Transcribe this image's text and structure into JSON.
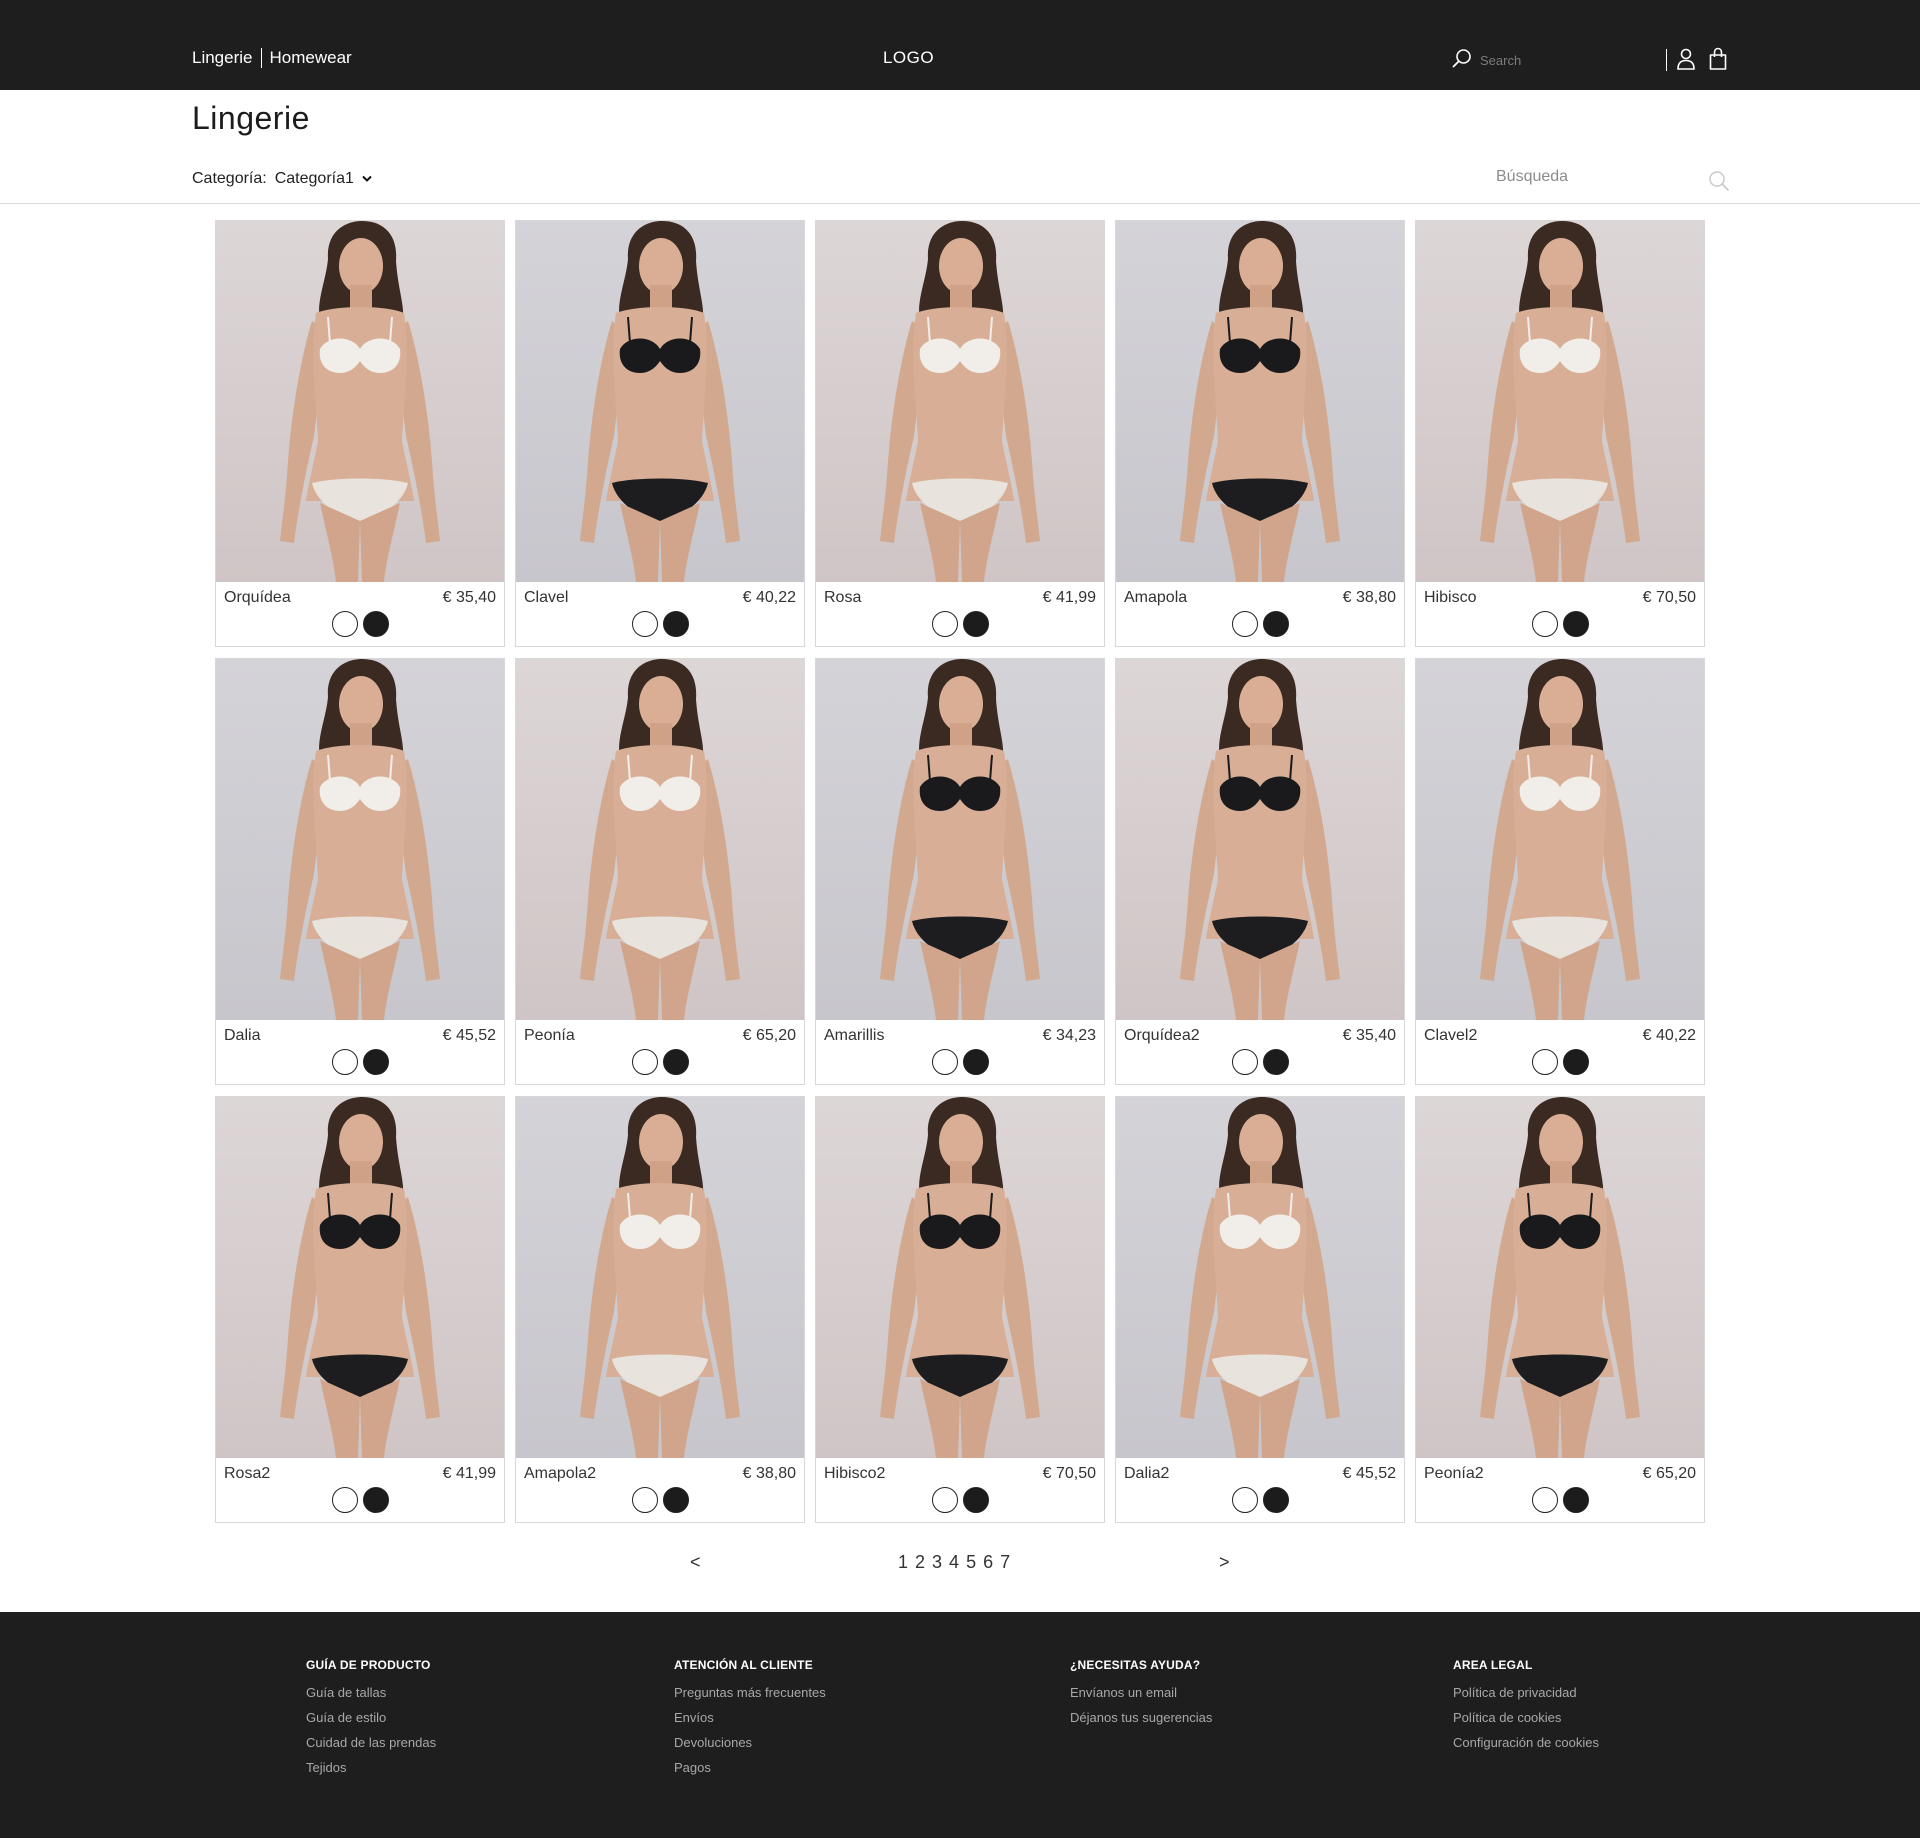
{
  "header": {
    "nav": [
      "Lingerie",
      "Homewear"
    ],
    "logo": "LOGO",
    "search_placeholder": "Search"
  },
  "page": {
    "title": "Lingerie",
    "filter_label": "Categoría:",
    "filter_value": "Categoría1",
    "search_placeholder": "Búsqueda"
  },
  "products": [
    {
      "name": "Orquídea",
      "price": "€ 35,40",
      "outfit": "white"
    },
    {
      "name": "Clavel",
      "price": "€ 40,22",
      "outfit": "black"
    },
    {
      "name": "Rosa",
      "price": "€ 41,99",
      "outfit": "white"
    },
    {
      "name": "Amapola",
      "price": "€ 38,80",
      "outfit": "black"
    },
    {
      "name": "Hibisco",
      "price": "€ 70,50",
      "outfit": "white"
    },
    {
      "name": "Dalia",
      "price": "€ 45,52",
      "outfit": "white"
    },
    {
      "name": "Peonía",
      "price": "€ 65,20",
      "outfit": "white"
    },
    {
      "name": "Amarillis",
      "price": "€ 34,23",
      "outfit": "black"
    },
    {
      "name": "Orquídea2",
      "price": "€ 35,40",
      "outfit": "black"
    },
    {
      "name": "Clavel2",
      "price": "€ 40,22",
      "outfit": "white"
    },
    {
      "name": "Rosa2",
      "price": "€ 41,99",
      "outfit": "black"
    },
    {
      "name": "Amapola2",
      "price": "€ 38,80",
      "outfit": "white"
    },
    {
      "name": "Hibisco2",
      "price": "€ 70,50",
      "outfit": "black"
    },
    {
      "name": "Dalia2",
      "price": "€ 45,52",
      "outfit": "white"
    },
    {
      "name": "Peonía2",
      "price": "€ 65,20",
      "outfit": "black"
    }
  ],
  "pagination": {
    "prev": "<",
    "next": ">",
    "pages": [
      "1",
      "2",
      "3",
      "4",
      "5",
      "6",
      "7"
    ]
  },
  "footer": {
    "columns": [
      {
        "title": "GUÍA DE PRODUCTO",
        "links": [
          "Guía de tallas",
          "Guía de estilo",
          "Cuidad de las prendas",
          "Tejidos"
        ]
      },
      {
        "title": "ATENCIÓN AL CLIENTE",
        "links": [
          "Preguntas más frecuentes",
          "Envíos",
          "Devoluciones",
          "Pagos"
        ]
      },
      {
        "title": "¿NECESITAS AYUDA?",
        "links": [
          "Envíanos un email",
          "Déjanos tus sugerencias"
        ]
      },
      {
        "title": "AREA LEGAL",
        "links": [
          "Política de privacidad",
          "Política de cookies",
          "Configuración de cookies"
        ]
      }
    ]
  },
  "colors": {
    "header_bg": "#1e1e1e",
    "footer_bg": "#1e1e1e",
    "swatch_white": "#ffffff",
    "swatch_black": "#1c1c1c"
  },
  "icons": [
    "search-icon",
    "user-icon",
    "shopping-bag-icon",
    "chevron-down-icon"
  ]
}
